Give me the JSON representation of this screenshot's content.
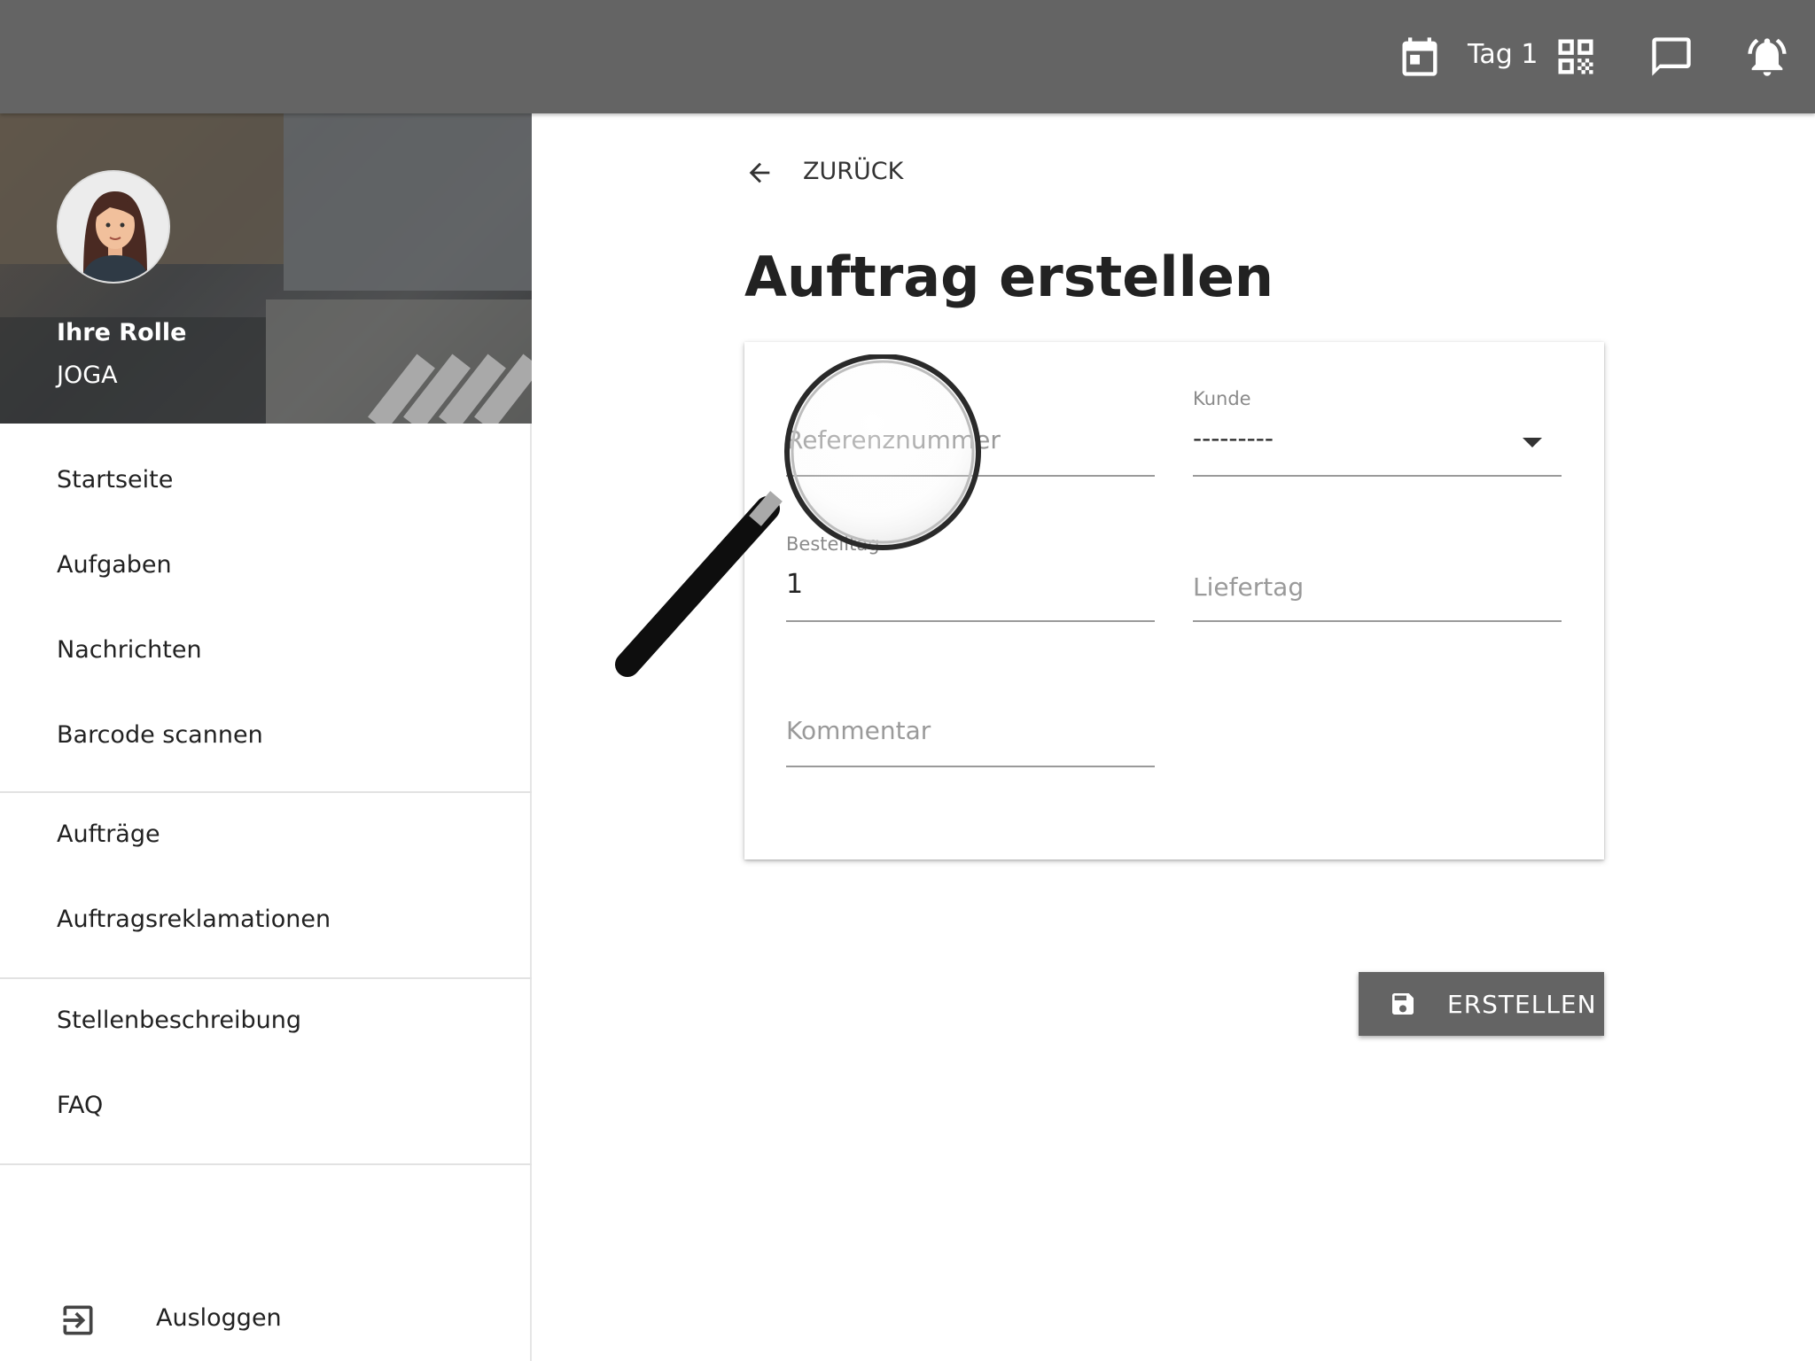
{
  "topbar": {
    "day_label": "Tag 1",
    "icons": [
      "calendar-icon",
      "qr-code-icon",
      "chat-icon",
      "alarm-bell-icon"
    ],
    "background": "#646464"
  },
  "sidebar": {
    "role_title": "Ihre Rolle",
    "role_value": "JOGA",
    "items": [
      {
        "label": "Startseite"
      },
      {
        "label": "Aufgaben"
      },
      {
        "label": "Nachrichten"
      },
      {
        "label": "Barcode scannen"
      },
      {
        "label": "Aufträge"
      },
      {
        "label": "Auftragsreklamationen"
      },
      {
        "label": "Stellenbeschreibung"
      },
      {
        "label": "FAQ"
      }
    ],
    "logout_label": "Ausloggen"
  },
  "main": {
    "back_label": "ZURÜCK",
    "title": "Auftrag erstellen",
    "form": {
      "reference": {
        "placeholder": "Referenznummer"
      },
      "customer": {
        "label": "Kunde",
        "value": "---------"
      },
      "order_day": {
        "label": "Bestelltag",
        "value": "1"
      },
      "delivery_day": {
        "placeholder": "Liefertag"
      },
      "comment": {
        "placeholder": "Kommentar"
      }
    },
    "create_label": "ERSTELLEN"
  }
}
